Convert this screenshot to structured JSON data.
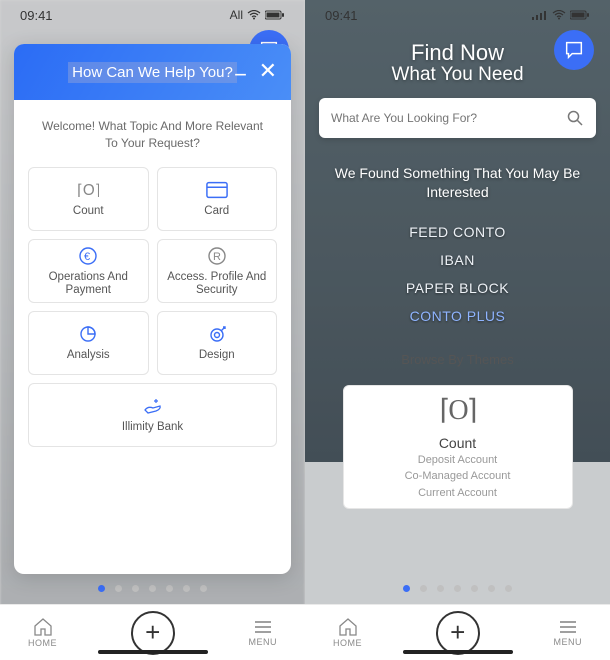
{
  "status": {
    "time": "09:41",
    "carrier": "All"
  },
  "left": {
    "modal": {
      "title": "How Can We Help You?",
      "welcome": "Welcome! What Topic And More Relevant To Your Request?",
      "tiles": {
        "count": "Count",
        "card": "Card",
        "ops": "Operations And Payment",
        "access": "Access. Profile And Security",
        "analysis": "Analysis",
        "design": "Design",
        "illimity": "Illimity Bank"
      }
    }
  },
  "right": {
    "headline1": "Find Now",
    "headline2": "What You Need",
    "search_placeholder": "What Are You Looking For?",
    "found": "We Found Something That You May Be Interested",
    "chips": {
      "c1": "FEED CONTO",
      "c2": "IBAN",
      "c3": "PAPER BLOCK",
      "c4": "CONTO PLUS"
    },
    "browse": "Browse By Themes",
    "card": {
      "title": "Count",
      "s1": "Deposit Account",
      "s2": "Co-Managed Account",
      "s3": "Current Account"
    }
  },
  "nav": {
    "home": "HOME",
    "menu": "MENU"
  }
}
